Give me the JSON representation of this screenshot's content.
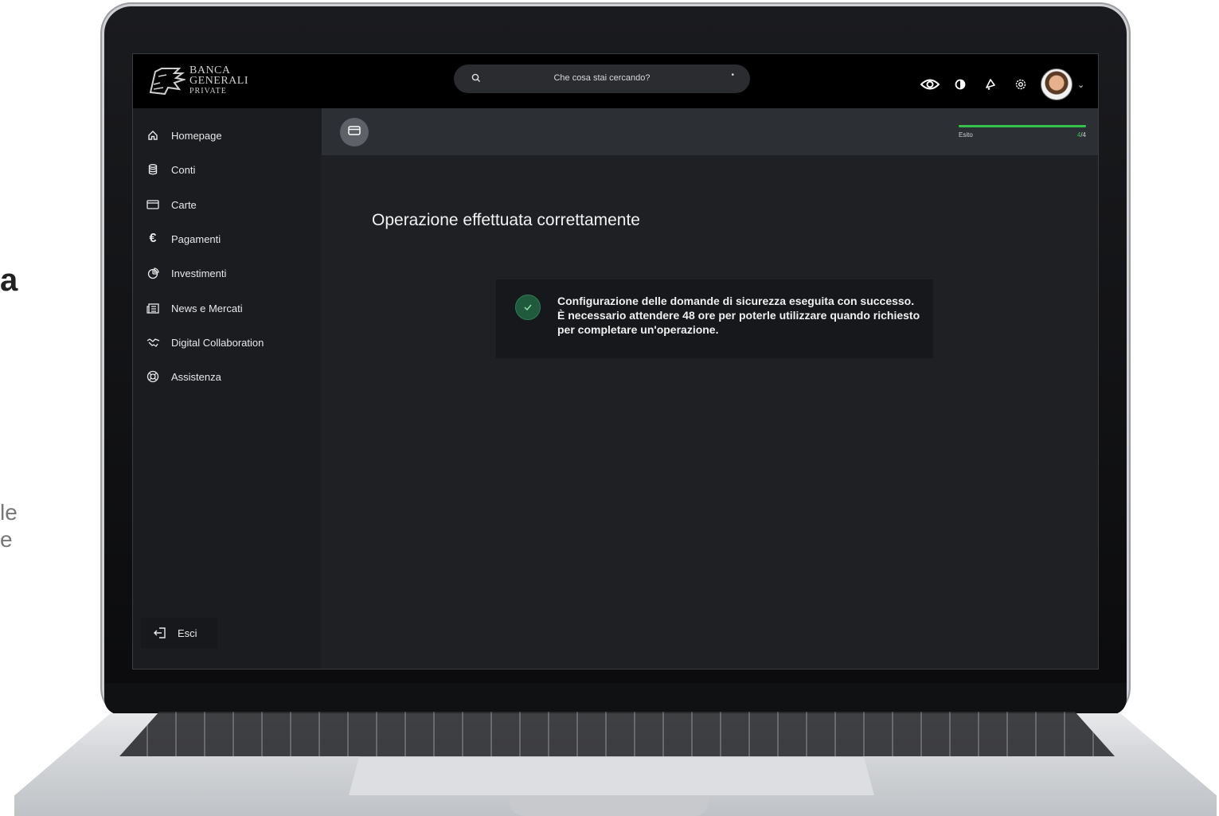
{
  "slide": {
    "cropped_heading": "a",
    "cropped_line1": "le",
    "cropped_line2": "e"
  },
  "header": {
    "brand_line1": "BANCA",
    "brand_line2": "GENERALI",
    "brand_line3": "PRIVATE",
    "search_placeholder": "Che cosa stai cercando?",
    "icons": [
      "eye-icon",
      "contrast-icon",
      "notifications-icon",
      "settings-icon",
      "avatar",
      "chevron-down-icon"
    ]
  },
  "sidebar": {
    "items": [
      {
        "label": "Homepage",
        "icon": "home-icon"
      },
      {
        "label": "Conti",
        "icon": "accounts-icon"
      },
      {
        "label": "Carte",
        "icon": "card-icon"
      },
      {
        "label": "Pagamenti",
        "icon": "euro-icon"
      },
      {
        "label": "Investimenti",
        "icon": "pie-chart-icon"
      },
      {
        "label": "News e Mercati",
        "icon": "news-icon"
      },
      {
        "label": "Digital Collaboration",
        "icon": "handshake-icon"
      },
      {
        "label": "Assistenza",
        "icon": "lifebuoy-icon"
      }
    ],
    "exit_label": "Esci"
  },
  "progress": {
    "label": "Esito",
    "current": "4",
    "total": "/4",
    "fraction": 1.0,
    "color": "#35c24a"
  },
  "main": {
    "title": "Operazione effettuata correttamente",
    "message": "Configurazione delle domande di sicurezza eseguita con successo. È necessario attendere 48 ore per poterle utilizzare quando richiesto per completare un'operazione."
  }
}
